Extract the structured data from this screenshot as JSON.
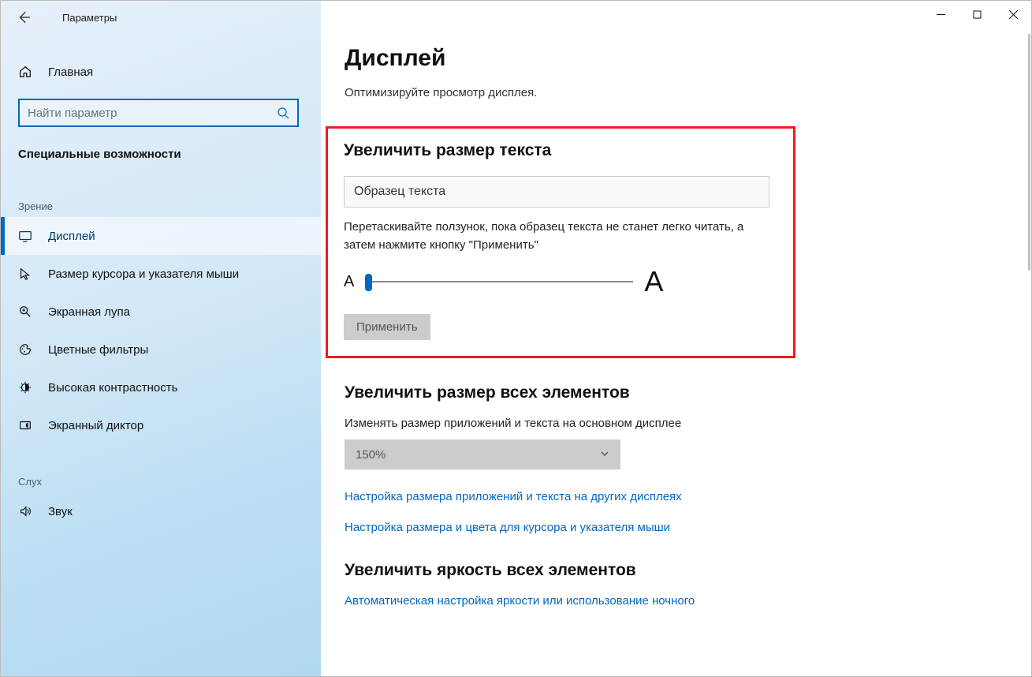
{
  "window": {
    "app_title": "Параметры"
  },
  "sidebar": {
    "home_label": "Главная",
    "search_placeholder": "Найти параметр",
    "category_title": "Специальные возможности",
    "groups": {
      "vision": "Зрение",
      "hearing": "Слух"
    },
    "items": {
      "display": "Дисплей",
      "cursor": "Размер курсора и указателя мыши",
      "magnifier": "Экранная лупа",
      "color_filters": "Цветные фильтры",
      "high_contrast": "Высокая контрастность",
      "narrator": "Экранный диктор",
      "sound": "Звук"
    }
  },
  "main": {
    "title": "Дисплей",
    "subtitle": "Оптимизируйте просмотр дисплея.",
    "text_size": {
      "heading": "Увеличить размер текста",
      "sample": "Образец текста",
      "help": "Перетаскивайте ползунок, пока образец текста не станет легко читать, а затем нажмите кнопку \"Применить\"",
      "small_a": "A",
      "large_a": "A",
      "apply": "Применить"
    },
    "scale_all": {
      "heading": "Увеличить размер всех элементов",
      "desc": "Изменять размер приложений и текста на основном дисплее",
      "value": "150%",
      "link_other_displays": "Настройка размера приложений и текста на других дисплеях",
      "link_cursor": "Настройка размера и цвета для курсора и указателя мыши"
    },
    "brightness": {
      "heading": "Увеличить яркость всех элементов",
      "link_auto": "Автоматическая настройка яркости или использование ночного"
    }
  }
}
